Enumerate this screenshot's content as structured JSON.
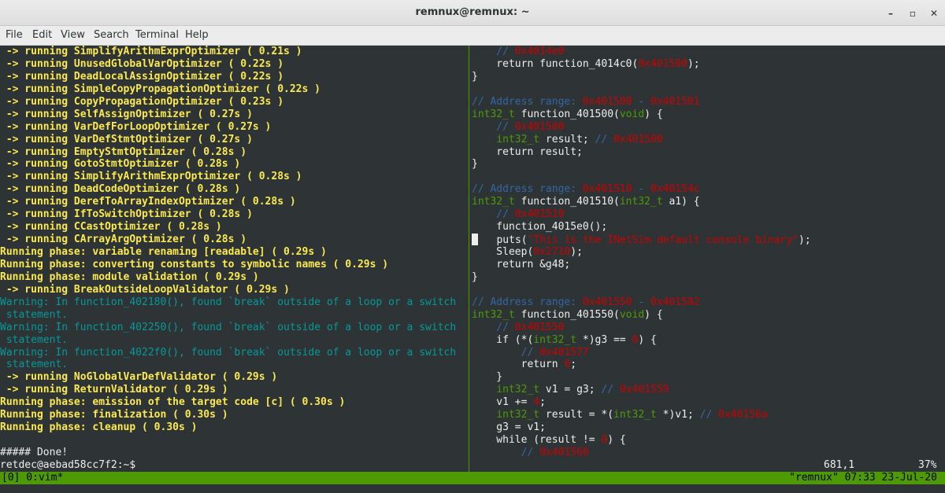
{
  "window": {
    "title": "remnux@remnux: ~",
    "minimize_glyph": "–",
    "maximize_glyph": "▫",
    "close_glyph": "✕"
  },
  "menu": [
    "File",
    "Edit",
    "View",
    "Search",
    "Terminal",
    "Help"
  ],
  "left_lines": [
    [
      {
        "t": " -> running SimplifyArithmExprOptimizer ( 0.21s )",
        "c": "yb"
      }
    ],
    [
      {
        "t": " -> running UnusedGlobalVarOptimizer ( 0.22s )",
        "c": "yb"
      }
    ],
    [
      {
        "t": " -> running DeadLocalAssignOptimizer ( 0.22s )",
        "c": "yb"
      }
    ],
    [
      {
        "t": " -> running SimpleCopyPropagationOptimizer ( 0.22s )",
        "c": "yb"
      }
    ],
    [
      {
        "t": " -> running CopyPropagationOptimizer ( 0.23s )",
        "c": "yb"
      }
    ],
    [
      {
        "t": " -> running SelfAssignOptimizer ( 0.27s )",
        "c": "yb"
      }
    ],
    [
      {
        "t": " -> running VarDefForLoopOptimizer ( 0.27s )",
        "c": "yb"
      }
    ],
    [
      {
        "t": " -> running VarDefStmtOptimizer ( 0.27s )",
        "c": "yb"
      }
    ],
    [
      {
        "t": " -> running EmptyStmtOptimizer ( 0.28s )",
        "c": "yb"
      }
    ],
    [
      {
        "t": " -> running GotoStmtOptimizer ( 0.28s )",
        "c": "yb"
      }
    ],
    [
      {
        "t": " -> running SimplifyArithmExprOptimizer ( 0.28s )",
        "c": "yb"
      }
    ],
    [
      {
        "t": " -> running DeadCodeOptimizer ( 0.28s )",
        "c": "yb"
      }
    ],
    [
      {
        "t": " -> running DerefToArrayIndexOptimizer ( 0.28s )",
        "c": "yb"
      }
    ],
    [
      {
        "t": " -> running IfToSwitchOptimizer ( 0.28s )",
        "c": "yb"
      }
    ],
    [
      {
        "t": " -> running CCastOptimizer ( 0.28s )",
        "c": "yb"
      }
    ],
    [
      {
        "t": " -> running CArrayArgOptimizer ( 0.28s )",
        "c": "yb"
      }
    ],
    [
      {
        "t": "Running phase: variable renaming [readable] ( 0.29s )",
        "c": "yb"
      }
    ],
    [
      {
        "t": "Running phase: converting constants to symbolic names ( 0.29s )",
        "c": "yb"
      }
    ],
    [
      {
        "t": "Running phase: module validation ( 0.29s )",
        "c": "yb"
      }
    ],
    [
      {
        "t": " -> running BreakOutsideLoopValidator ( 0.29s )",
        "c": "yb"
      }
    ],
    [
      {
        "t": "Warning: In function_402180(), found `break` outside of a loop or a switch",
        "c": "cy"
      }
    ],
    [
      {
        "t": " statement.",
        "c": "cy"
      }
    ],
    [
      {
        "t": "Warning: In function_402250(), found `break` outside of a loop or a switch",
        "c": "cy"
      }
    ],
    [
      {
        "t": " statement.",
        "c": "cy"
      }
    ],
    [
      {
        "t": "Warning: In function_4022f0(), found `break` outside of a loop or a switch",
        "c": "cy"
      }
    ],
    [
      {
        "t": " statement.",
        "c": "cy"
      }
    ],
    [
      {
        "t": " -> running NoGlobalVarDefValidator ( 0.29s )",
        "c": "yb"
      }
    ],
    [
      {
        "t": " -> running ReturnValidator ( 0.29s )",
        "c": "yb"
      }
    ],
    [
      {
        "t": "Running phase: emission of the target code [c] ( 0.30s )",
        "c": "yb"
      }
    ],
    [
      {
        "t": "Running phase: finalization ( 0.30s )",
        "c": "yb"
      }
    ],
    [
      {
        "t": "Running phase: cleanup ( 0.30s )",
        "c": "yb"
      }
    ],
    [
      {
        "t": "",
        "c": "wt"
      }
    ],
    [
      {
        "t": "##### Done!",
        "c": "wt"
      }
    ],
    [
      {
        "t": "retdec@aebad58cc7f2:~$",
        "c": "wt"
      }
    ]
  ],
  "right_lines": [
    [
      {
        "t": "    // ",
        "c": "bl"
      },
      {
        "t": "0x4014e0",
        "c": "rd"
      }
    ],
    [
      {
        "t": "    return function_4014c0(",
        "c": "wt"
      },
      {
        "t": "0x401500",
        "c": "rd"
      },
      {
        "t": ");",
        "c": "wt"
      }
    ],
    [
      {
        "t": "}",
        "c": "wt"
      }
    ],
    [
      {
        "t": "",
        "c": "wt"
      }
    ],
    [
      {
        "t": "// Address range: ",
        "c": "bl"
      },
      {
        "t": "0x401500",
        "c": "rd"
      },
      {
        "t": " - ",
        "c": "bl"
      },
      {
        "t": "0x401501",
        "c": "rd"
      }
    ],
    [
      {
        "t": "int32_t",
        "c": "gn"
      },
      {
        "t": " function_401500(",
        "c": "wt"
      },
      {
        "t": "void",
        "c": "gn"
      },
      {
        "t": ") {",
        "c": "wt"
      }
    ],
    [
      {
        "t": "    // ",
        "c": "bl"
      },
      {
        "t": "0x401500",
        "c": "rd"
      }
    ],
    [
      {
        "t": "    ",
        "c": "wt"
      },
      {
        "t": "int32_t",
        "c": "gn"
      },
      {
        "t": " result; ",
        "c": "wt"
      },
      {
        "t": "// ",
        "c": "bl"
      },
      {
        "t": "0x401500",
        "c": "rd"
      }
    ],
    [
      {
        "t": "    return result;",
        "c": "wt"
      }
    ],
    [
      {
        "t": "}",
        "c": "wt"
      }
    ],
    [
      {
        "t": "",
        "c": "wt"
      }
    ],
    [
      {
        "t": "// Address range: ",
        "c": "bl"
      },
      {
        "t": "0x401510",
        "c": "rd"
      },
      {
        "t": " - ",
        "c": "bl"
      },
      {
        "t": "0x40154c",
        "c": "rd"
      }
    ],
    [
      {
        "t": "int32_t",
        "c": "gn"
      },
      {
        "t": " function_401510(",
        "c": "wt"
      },
      {
        "t": "int32_t",
        "c": "gn"
      },
      {
        "t": " a1) {",
        "c": "wt"
      }
    ],
    [
      {
        "t": "    // ",
        "c": "bl"
      },
      {
        "t": "0x401510",
        "c": "rd"
      }
    ],
    [
      {
        "t": "    function_4015e0();",
        "c": "wt"
      }
    ],
    [
      {
        "t": "CURSOR",
        "c": "cur"
      },
      {
        "t": "   puts(",
        "c": "wt"
      },
      {
        "t": "\"This is the INetSim default console binary\"",
        "c": "rd"
      },
      {
        "t": ");",
        "c": "wt"
      }
    ],
    [
      {
        "t": "    Sleep(",
        "c": "wt"
      },
      {
        "t": "0x2710",
        "c": "rd"
      },
      {
        "t": ");",
        "c": "wt"
      }
    ],
    [
      {
        "t": "    return &g48;",
        "c": "wt"
      }
    ],
    [
      {
        "t": "}",
        "c": "wt"
      }
    ],
    [
      {
        "t": "",
        "c": "wt"
      }
    ],
    [
      {
        "t": "// Address range: ",
        "c": "bl"
      },
      {
        "t": "0x401550",
        "c": "rd"
      },
      {
        "t": " - ",
        "c": "bl"
      },
      {
        "t": "0x401582",
        "c": "rd"
      }
    ],
    [
      {
        "t": "int32_t",
        "c": "gn"
      },
      {
        "t": " function_401550(",
        "c": "wt"
      },
      {
        "t": "void",
        "c": "gn"
      },
      {
        "t": ") {",
        "c": "wt"
      }
    ],
    [
      {
        "t": "    // ",
        "c": "bl"
      },
      {
        "t": "0x401550",
        "c": "rd"
      }
    ],
    [
      {
        "t": "    if (*(",
        "c": "wt"
      },
      {
        "t": "int32_t",
        "c": "gn"
      },
      {
        "t": " *)g3 == ",
        "c": "wt"
      },
      {
        "t": "0",
        "c": "rd"
      },
      {
        "t": ") {",
        "c": "wt"
      }
    ],
    [
      {
        "t": "        // ",
        "c": "bl"
      },
      {
        "t": "0x401577",
        "c": "rd"
      }
    ],
    [
      {
        "t": "        return ",
        "c": "wt"
      },
      {
        "t": "0",
        "c": "rd"
      },
      {
        "t": ";",
        "c": "wt"
      }
    ],
    [
      {
        "t": "    }",
        "c": "wt"
      }
    ],
    [
      {
        "t": "    ",
        "c": "wt"
      },
      {
        "t": "int32_t",
        "c": "gn"
      },
      {
        "t": " v1 = g3; ",
        "c": "wt"
      },
      {
        "t": "// ",
        "c": "bl"
      },
      {
        "t": "0x401559",
        "c": "rd"
      }
    ],
    [
      {
        "t": "    v1 += ",
        "c": "wt"
      },
      {
        "t": "4",
        "c": "rd"
      },
      {
        "t": ";",
        "c": "wt"
      }
    ],
    [
      {
        "t": "    ",
        "c": "wt"
      },
      {
        "t": "int32_t",
        "c": "gn"
      },
      {
        "t": " result = *(",
        "c": "wt"
      },
      {
        "t": "int32_t",
        "c": "gn"
      },
      {
        "t": " *)v1; ",
        "c": "wt"
      },
      {
        "t": "// ",
        "c": "bl"
      },
      {
        "t": "0x40156a",
        "c": "rd"
      }
    ],
    [
      {
        "t": "    g3 = v1;",
        "c": "wt"
      }
    ],
    [
      {
        "t": "    while (result != ",
        "c": "wt"
      },
      {
        "t": "0",
        "c": "rd"
      },
      {
        "t": ") {",
        "c": "wt"
      }
    ],
    [
      {
        "t": "        // ",
        "c": "bl"
      },
      {
        "t": "0x401560",
        "c": "rd"
      }
    ],
    [
      {
        "t": "POSLINE",
        "c": "pos"
      }
    ]
  ],
  "vim_ruler": {
    "position": "681,1",
    "percent": "37%"
  },
  "tmux": {
    "left": "[0] 0:vim*",
    "right": "\"remnux\" 07:33 23-Jul-20"
  }
}
